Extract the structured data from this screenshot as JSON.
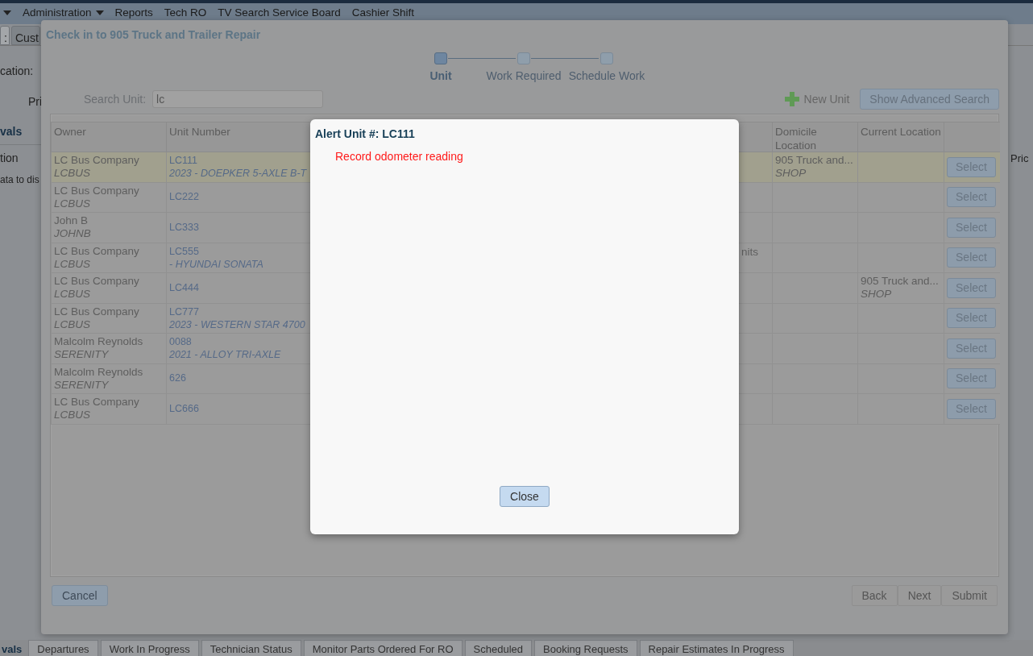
{
  "nav": {
    "items": [
      {
        "dropdown": true
      },
      {
        "label": "Administration",
        "dropdown": true
      },
      {
        "label": "Reports",
        "dropdown": false
      },
      {
        "label": "Tech RO",
        "dropdown": false
      },
      {
        "label": "TV Search Service Board",
        "dropdown": false
      },
      {
        "label": "Cashier Shift",
        "dropdown": false
      }
    ]
  },
  "background": {
    "tabs": [
      {
        "label": ":",
        "selected": true
      },
      {
        "label": "Cust",
        "selected": false
      }
    ],
    "location_label": "cation:",
    "price_label": "Pri",
    "section_title": "vals",
    "column_label": "tion",
    "empty_message": "ata to dis",
    "right_label": "Pric"
  },
  "bottom_tabs": [
    {
      "label": "vals",
      "selected": true
    },
    {
      "label": "Departures",
      "selected": false
    },
    {
      "label": "Work In Progress",
      "selected": false
    },
    {
      "label": "Technician Status",
      "selected": false
    },
    {
      "label": "Monitor Parts Ordered For RO",
      "selected": false
    },
    {
      "label": "Scheduled",
      "selected": false
    },
    {
      "label": "Booking Requests",
      "selected": false
    },
    {
      "label": "Repair Estimates In Progress",
      "selected": false
    }
  ],
  "dialog": {
    "title": "Check in to 905 Truck and Trailer Repair",
    "steps": [
      {
        "label": "Unit",
        "selected": true
      },
      {
        "label": "Work Required",
        "selected": false
      },
      {
        "label": "Schedule Work",
        "selected": false
      }
    ],
    "search": {
      "label": "Search Unit:",
      "value": "lc"
    },
    "new_unit": "New Unit",
    "advanced_search": "Show Advanced Search",
    "table": {
      "columns": [
        {
          "label": "Owner"
        },
        {
          "label": "Unit Number"
        },
        {},
        {},
        {
          "label": "Domicile Location"
        },
        {
          "label": "Current Location"
        },
        {}
      ],
      "rows": [
        {
          "owner": "LC Bus Company",
          "owner_code": "LCBUS",
          "unit": "LC111",
          "unit_desc": "2023 - DOEPKER 5-AXLE B-T",
          "domicile": "905 Truck and...",
          "domicile_code": "SHOP",
          "action": "Select",
          "selected": true
        },
        {
          "owner": "LC Bus Company",
          "owner_code": "LCBUS",
          "unit": "LC222",
          "action": "Select",
          "selected": false
        },
        {
          "owner": "John B",
          "owner_code": "JOHNB",
          "unit": "LC333",
          "action": "Select",
          "selected": false
        },
        {
          "owner": "LC Bus Company",
          "owner_code": "LCBUS",
          "unit": "LC555",
          "unit_desc": "- HYUNDAI SONATA",
          "column_4": "nits",
          "action": "Select",
          "selected": false
        },
        {
          "owner": "LC Bus Company",
          "owner_code": "LCBUS",
          "unit": "LC444",
          "current": "905 Truck and...",
          "current_code": "SHOP",
          "action": "Select",
          "selected": false
        },
        {
          "owner": "LC Bus Company",
          "owner_code": "LCBUS",
          "unit": "LC777",
          "unit_desc": "2023 - WESTERN STAR 4700",
          "action": "Select",
          "selected": false
        },
        {
          "owner": "Malcolm Reynolds",
          "owner_code": "SERENITY",
          "unit": "0088",
          "unit_desc": "2021 - ALLOY TRI-AXLE",
          "action": "Select",
          "selected": false
        },
        {
          "owner": "Malcolm Reynolds",
          "owner_code": "SERENITY",
          "unit": "626",
          "action": "Select",
          "selected": false
        },
        {
          "owner": "LC Bus Company",
          "owner_code": "LCBUS",
          "unit": "LC666",
          "action": "Select",
          "selected": false
        }
      ]
    },
    "cancel": {
      "label": "Cancel",
      "disabled": false
    },
    "buttons": [
      {
        "label": "Back",
        "disabled": true
      },
      {
        "label": "Next",
        "disabled": true
      },
      {
        "label": "Submit",
        "disabled": true
      }
    ]
  },
  "alert": {
    "title": "Alert Unit #: LC111",
    "message": "Record odometer reading",
    "close": "Close"
  }
}
